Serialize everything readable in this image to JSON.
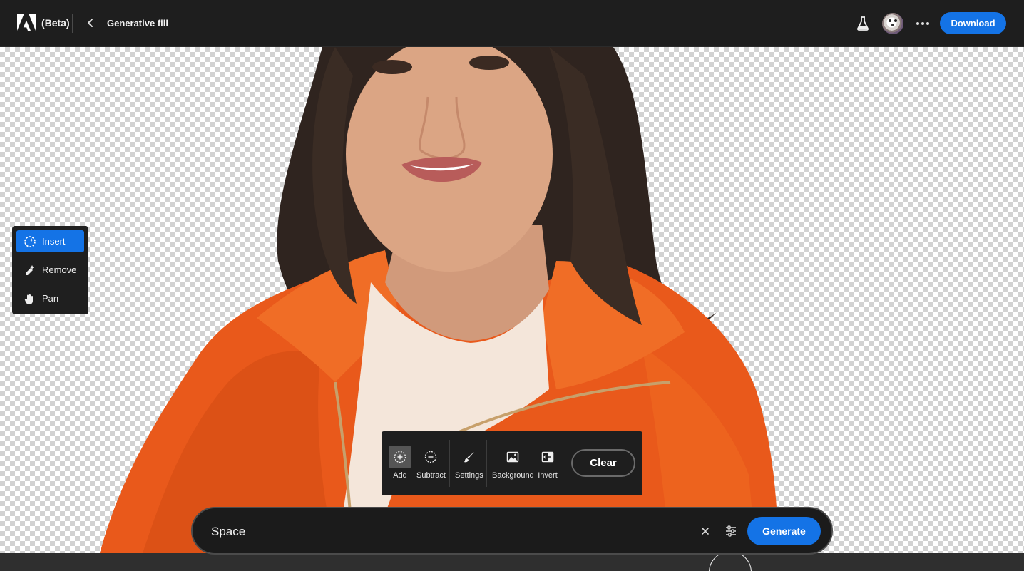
{
  "header": {
    "product": "(Beta)",
    "title": "Generative fill",
    "download_label": "Download",
    "icons": [
      "adobe-logo",
      "back-chevron",
      "labs-flask-icon",
      "user-avatar",
      "more-icon"
    ]
  },
  "tool_panel": {
    "items": [
      {
        "label": "Insert",
        "icon": "insert-sparkle-icon",
        "active": true
      },
      {
        "label": "Remove",
        "icon": "remove-eraser-icon",
        "active": false
      },
      {
        "label": "Pan",
        "icon": "hand-icon",
        "active": false
      }
    ]
  },
  "selection_toolbar": {
    "add": "Add",
    "subtract": "Subtract",
    "settings": "Settings",
    "background": "Background",
    "invert": "Invert",
    "clear": "Clear"
  },
  "prompt": {
    "value": "Space",
    "generate_label": "Generate"
  },
  "colors": {
    "accent": "#1473e6",
    "header_bg": "#1e1e1e",
    "panel_bg": "#1f1f1f",
    "jacket": "#ea5a1c",
    "shirt": "#f4e6da",
    "hair": "#2f241f",
    "skin": "#d7a181"
  }
}
